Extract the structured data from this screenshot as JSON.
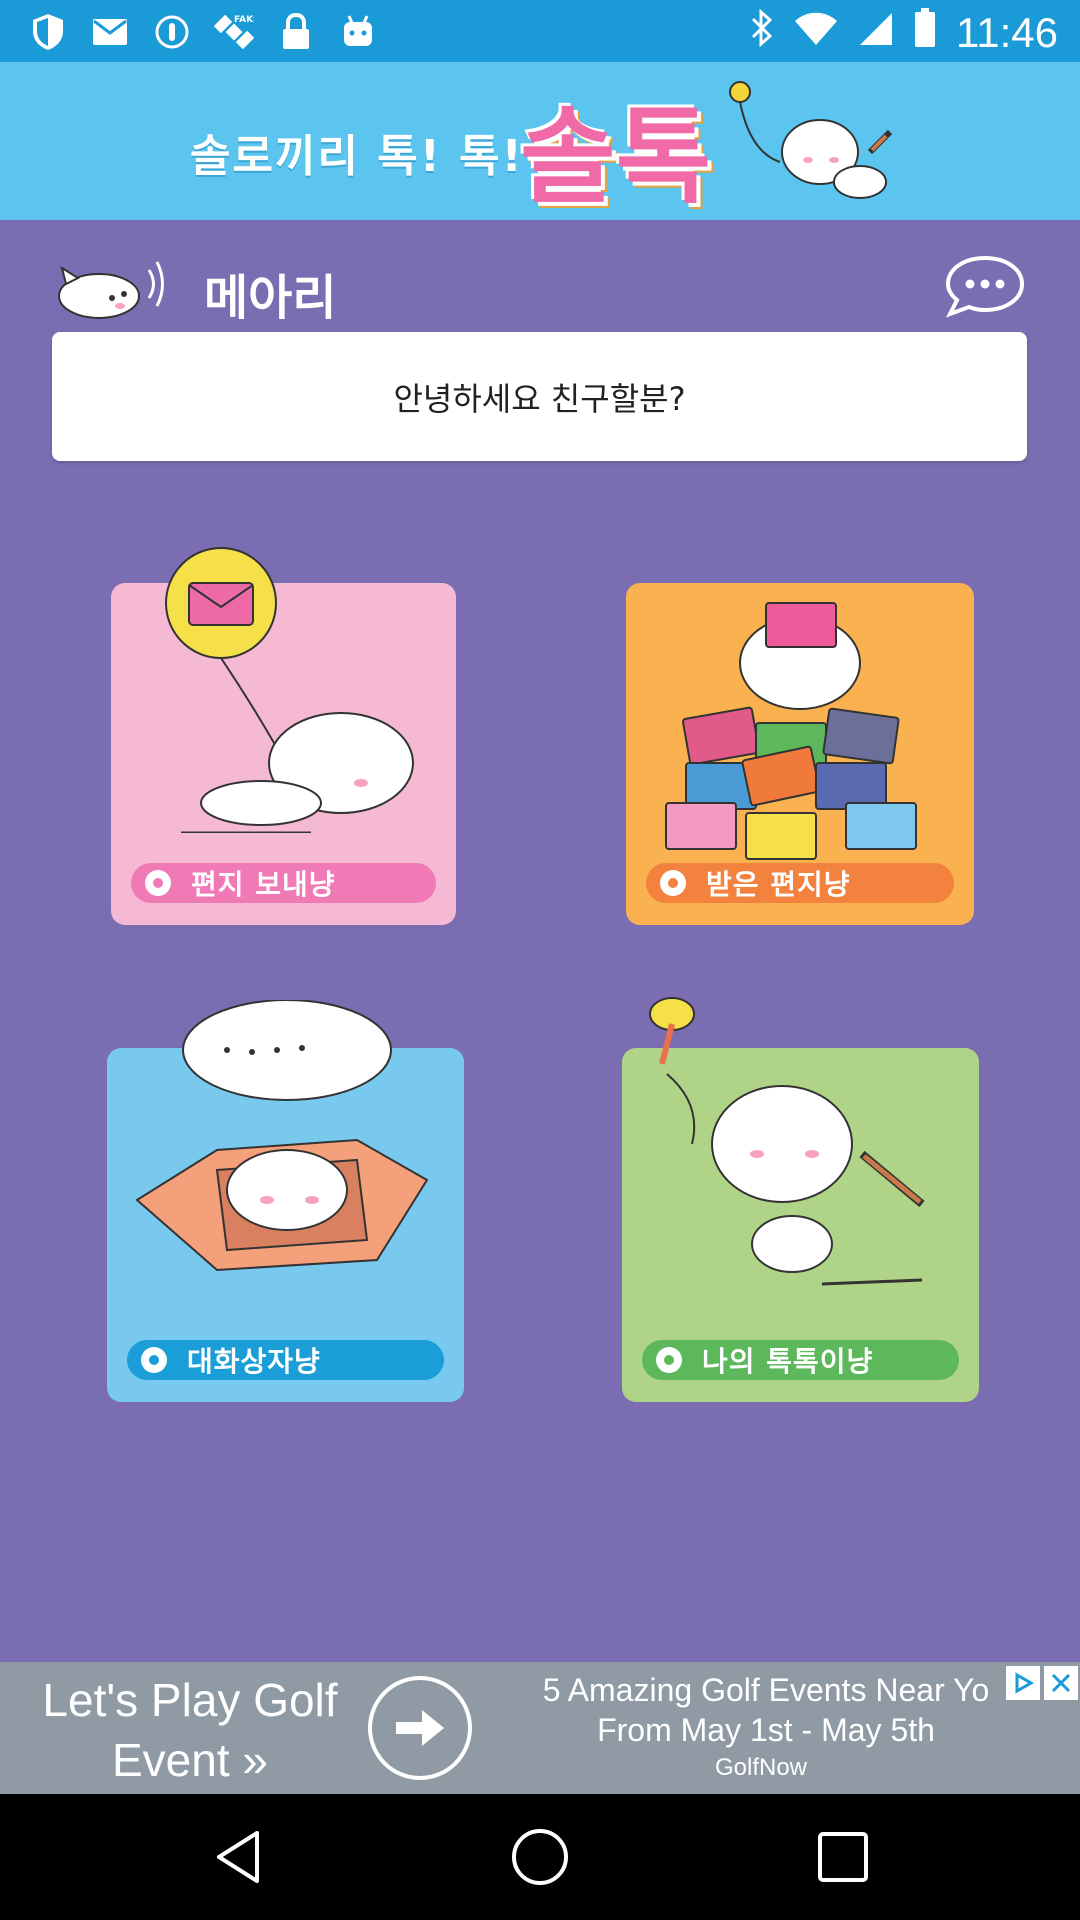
{
  "status_bar": {
    "time": "11:46",
    "icons": [
      "shield-icon",
      "mail-icon",
      "info-icon",
      "fake-gps-icon",
      "lock-icon",
      "android-icon",
      "bluetooth-icon",
      "wifi-icon",
      "signal-icon",
      "battery-icon"
    ]
  },
  "banner": {
    "tagline": "솔로끼리 톡! 톡!",
    "logo": "솔톡"
  },
  "profile": {
    "name": "메아리",
    "greeting": "안녕하세요 친구할분?"
  },
  "menu": [
    {
      "label": "편지 보내냥"
    },
    {
      "label": "받은 편지냥"
    },
    {
      "label": "대화상자냥"
    },
    {
      "label": "나의 톡톡이냥"
    }
  ],
  "ad": {
    "left_line1": "Let's Play Golf",
    "left_line2": "Event »",
    "headline_line1": "5 Amazing Golf Events Near Yo",
    "headline_line2": "From May 1st - May 5th",
    "source": "GolfNow"
  },
  "colors": {
    "status_bar": "#1a9ad6",
    "banner": "#5bc4ef",
    "background": "#7a6db1",
    "card_pink": "#f5b9d4",
    "card_orange": "#f9b24f",
    "card_blue": "#79c8ee",
    "card_green": "#b0d487"
  }
}
